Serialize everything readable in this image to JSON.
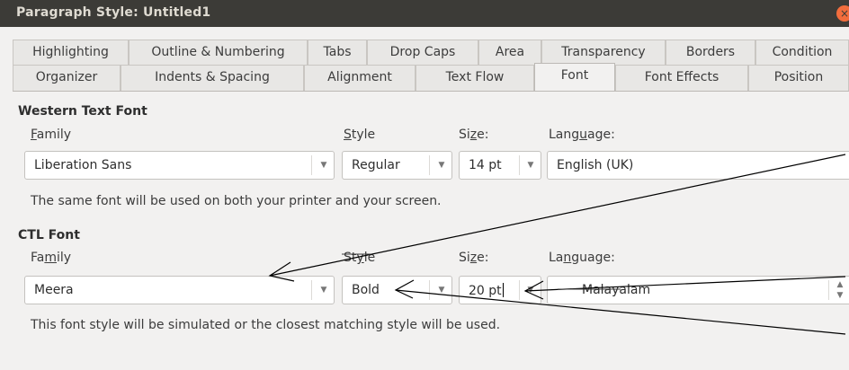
{
  "window": {
    "title": "Paragraph Style: Untitled1",
    "close_glyph": "×"
  },
  "tabs_row1": [
    {
      "label": "Highlighting"
    },
    {
      "label": "Outline & Numbering"
    },
    {
      "label": "Tabs"
    },
    {
      "label": "Drop Caps"
    },
    {
      "label": "Area"
    },
    {
      "label": "Transparency"
    },
    {
      "label": "Borders"
    },
    {
      "label": "Condition"
    }
  ],
  "tabs_row2": [
    {
      "label": "Organizer"
    },
    {
      "label": "Indents & Spacing"
    },
    {
      "label": "Alignment"
    },
    {
      "label": "Text Flow"
    },
    {
      "label": "Font",
      "active": true
    },
    {
      "label": "Font Effects"
    },
    {
      "label": "Position"
    }
  ],
  "western": {
    "heading": "Western Text Font",
    "family_label": {
      "a": "",
      "u": "F",
      "b": "amily"
    },
    "style_label": {
      "a": "",
      "u": "S",
      "b": "tyle"
    },
    "size_label": {
      "a": "Si",
      "u": "z",
      "b": "e:"
    },
    "language_label": {
      "a": "Lang",
      "u": "u",
      "b": "age:"
    },
    "family": "Liberation Sans",
    "style": "Regular",
    "size": "14 pt",
    "language": "English (UK)",
    "note": "The same font will be used on both your printer and your screen."
  },
  "ctl": {
    "heading": "CTL Font",
    "family_label": {
      "a": "Fa",
      "u": "m",
      "b": "ily"
    },
    "style_label": {
      "a": "St",
      "u": "y",
      "b": "le"
    },
    "size_label": {
      "a": "Si",
      "u": "z",
      "b": "e:"
    },
    "language_label": {
      "a": "La",
      "u": "n",
      "b": "guage:"
    },
    "family": "Meera",
    "style": "Bold",
    "size": "20 pt",
    "language": "Malayalam",
    "note": "This font style will be simulated or the closest matching style will be used."
  },
  "icons": {
    "dropdown": "dropdown-arrow-icon",
    "spin": "spin-up-down-icon"
  },
  "annotation_color": "#000000"
}
